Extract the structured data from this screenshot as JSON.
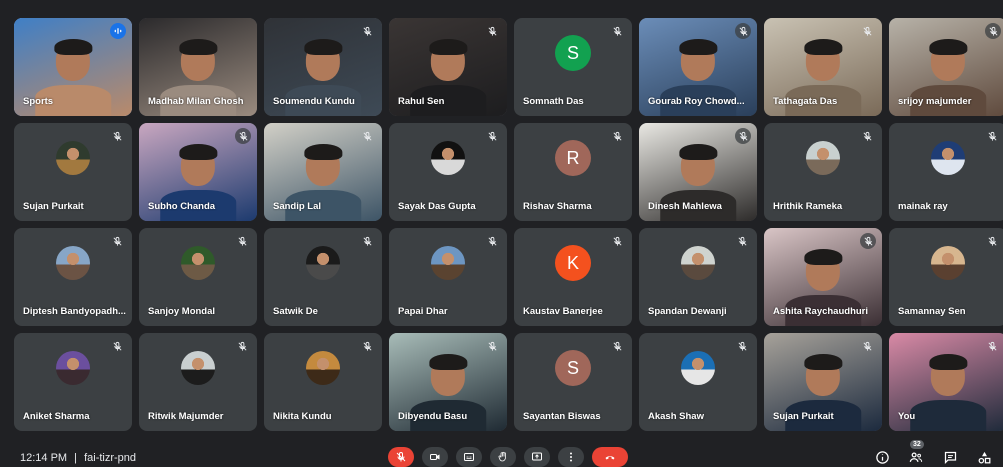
{
  "meeting": {
    "time": "12:14 PM",
    "separator": "|",
    "code": "fai-tizr-pnd"
  },
  "participant_count": "32",
  "participants": [
    {
      "name": "Sports",
      "kind": "video",
      "colors": [
        "#3f7fc6",
        "#b98a6a"
      ],
      "mic": "speaking",
      "active": true
    },
    {
      "name": "Madhab Milan Ghosh",
      "kind": "video",
      "colors": [
        "#2b2a2c",
        "#9a8b7f"
      ],
      "mic": "none"
    },
    {
      "name": "Soumendu Kundu",
      "kind": "video",
      "colors": [
        "#2f3237",
        "#3e4a56"
      ],
      "mic": "off"
    },
    {
      "name": "Rahul Sen",
      "kind": "video",
      "colors": [
        "#3a3534",
        "#1d1d1f"
      ],
      "mic": "off"
    },
    {
      "name": "Somnath Das",
      "kind": "letter",
      "letter": "S",
      "color": "#12a150",
      "mic": "off"
    },
    {
      "name": "Gourab Roy Chowd...",
      "kind": "video",
      "colors": [
        "#6b8db8",
        "#2a3f5a"
      ],
      "mic": "circle"
    },
    {
      "name": "Tathagata Das",
      "kind": "video",
      "colors": [
        "#c9c2b3",
        "#7a6a58"
      ],
      "mic": "off"
    },
    {
      "name": "srijoy majumder",
      "kind": "video",
      "colors": [
        "#b7b2a8",
        "#5f4a3d"
      ],
      "mic": "circle"
    },
    {
      "name": "Sujan Purkait",
      "kind": "photo",
      "colors": [
        "#2f3b2e",
        "#a2793f"
      ],
      "mic": "off"
    },
    {
      "name": "Subho Chanda",
      "kind": "video",
      "colors": [
        "#c9a7c0",
        "#1c3a6e"
      ],
      "mic": "circle"
    },
    {
      "name": "Sandip Lal",
      "kind": "video",
      "colors": [
        "#d2d0c7",
        "#3d5466"
      ],
      "mic": "off"
    },
    {
      "name": "Sayak Das Gupta",
      "kind": "photo",
      "colors": [
        "#111111",
        "#d9d9d9"
      ],
      "mic": "off"
    },
    {
      "name": "Rishav Sharma",
      "kind": "letter",
      "letter": "R",
      "color": "#a0675a",
      "mic": "off"
    },
    {
      "name": "Dinesh Mahlewa",
      "kind": "video",
      "colors": [
        "#e9e8e3",
        "#2d2b2a"
      ],
      "mic": "circle"
    },
    {
      "name": "Hrithik Rameka",
      "kind": "photo",
      "colors": [
        "#c8d0cf",
        "#7a6a5a"
      ],
      "mic": "off"
    },
    {
      "name": "mainak ray",
      "kind": "photo",
      "colors": [
        "#1f3d75",
        "#dee5ef"
      ],
      "mic": "off"
    },
    {
      "name": "Diptesh Bandyopadh...",
      "kind": "photo",
      "colors": [
        "#87a6c7",
        "#6b5344"
      ],
      "mic": "off"
    },
    {
      "name": "Sanjoy Mondal",
      "kind": "photo",
      "colors": [
        "#2f5a2a",
        "#6d5a45"
      ],
      "mic": "off"
    },
    {
      "name": "Satwik De",
      "kind": "photo",
      "colors": [
        "#1b1b1b",
        "#4a4a4a"
      ],
      "mic": "off"
    },
    {
      "name": "Papai Dhar",
      "kind": "photo",
      "colors": [
        "#6d96c2",
        "#5a4330"
      ],
      "mic": "off"
    },
    {
      "name": "Kaustav Banerjee",
      "kind": "letter",
      "letter": "K",
      "color": "#f4511e",
      "mic": "off"
    },
    {
      "name": "Spandan Dewanji",
      "kind": "photo",
      "colors": [
        "#cfd3cf",
        "#5a4a3e"
      ],
      "mic": "off"
    },
    {
      "name": "Ashita Raychaudhuri",
      "kind": "video",
      "colors": [
        "#d9c5c6",
        "#3b2f34"
      ],
      "mic": "circle"
    },
    {
      "name": "Samannay Sen",
      "kind": "photo",
      "colors": [
        "#d7b68f",
        "#5a4030"
      ],
      "mic": "off"
    },
    {
      "name": "Aniket Sharma",
      "kind": "photo",
      "colors": [
        "#6b4f9e",
        "#3a2a30"
      ],
      "mic": "off"
    },
    {
      "name": "Ritwik Majumder",
      "kind": "photo",
      "colors": [
        "#c9cfd0",
        "#1c1c1c"
      ],
      "mic": "off"
    },
    {
      "name": "Nikita Kundu",
      "kind": "photo",
      "colors": [
        "#c48a3e",
        "#3d2a18"
      ],
      "mic": "off"
    },
    {
      "name": "Dibyendu Basu",
      "kind": "video",
      "colors": [
        "#a8bcb8",
        "#1f2a33"
      ],
      "mic": "off"
    },
    {
      "name": "Sayantan Biswas",
      "kind": "letter",
      "letter": "S",
      "color": "#a0675a",
      "mic": "off"
    },
    {
      "name": "Akash Shaw",
      "kind": "photo",
      "colors": [
        "#1b6fb5",
        "#e6e6e6"
      ],
      "mic": "off"
    },
    {
      "name": "Sujan Purkait",
      "kind": "video",
      "colors": [
        "#a7a29a",
        "#1c2a3e"
      ],
      "mic": "off"
    },
    {
      "name": "You",
      "kind": "video",
      "colors": [
        "#d98aa6",
        "#1e2a3a"
      ],
      "mic": "off"
    }
  ],
  "controls": [
    "mic-off",
    "camera",
    "captions",
    "raise-hand",
    "present",
    "more",
    "end-call"
  ],
  "right_controls": [
    "info",
    "people",
    "chat",
    "activities"
  ]
}
